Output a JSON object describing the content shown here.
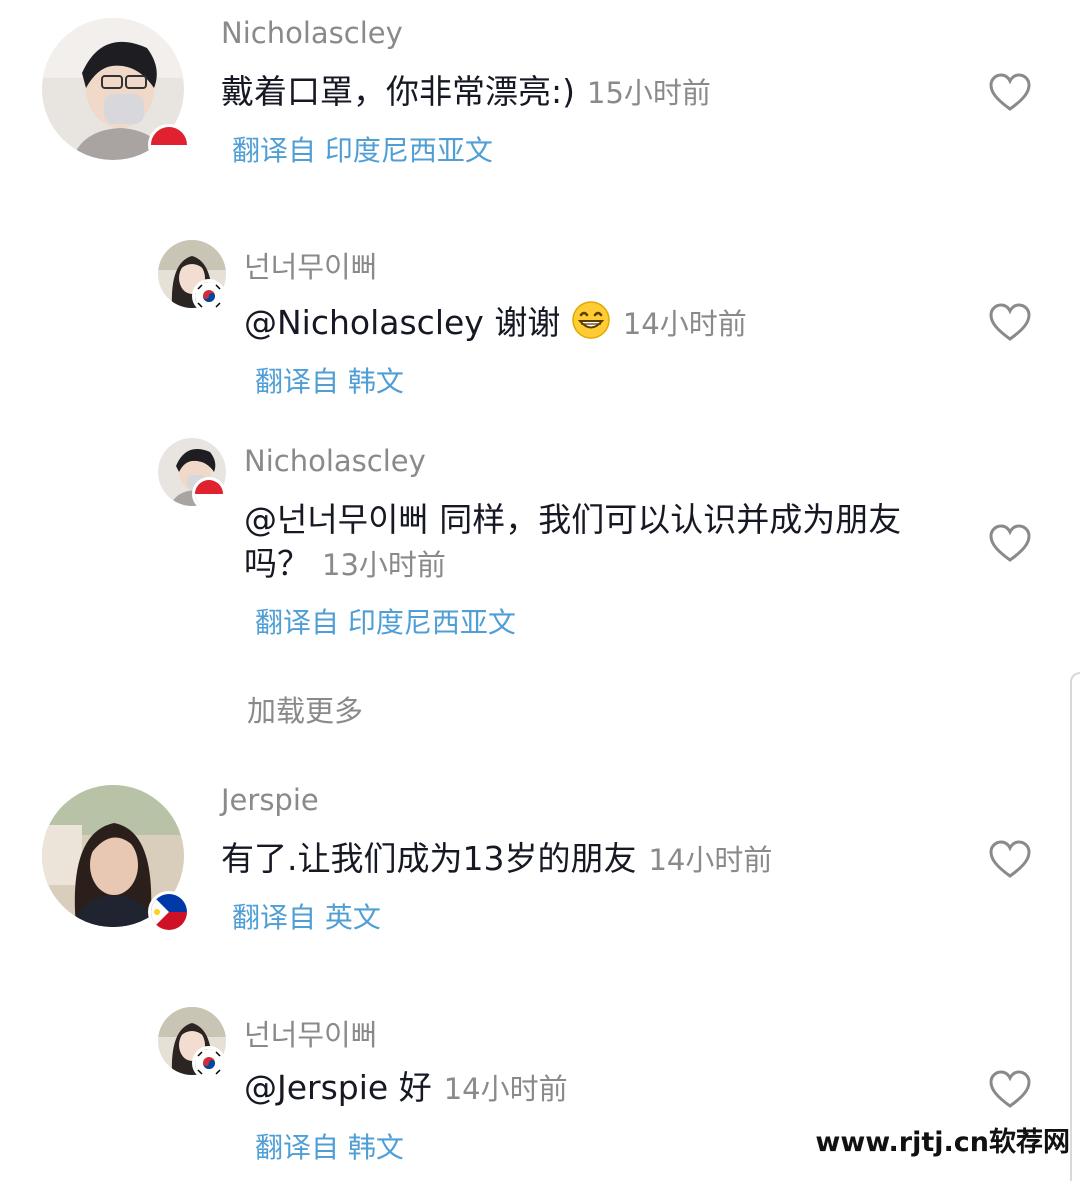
{
  "comments": [
    {
      "username": "Nicholascley",
      "text": "戴着口罩，你非常漂亮:)",
      "time": "15小时前",
      "translate": "翻译自 印度尼西亚文",
      "flag": "indonesia-flag-icon"
    },
    {
      "username": "넌너무이뻐",
      "text": "@Nicholascley 谢谢",
      "emoji": "grinning-face-icon",
      "time": "14小时前",
      "translate": "翻译自 韩文",
      "flag": "south-korea-flag-icon"
    },
    {
      "username": "Nicholascley",
      "text": "@넌너무이뻐 同样，我们可以认识并成为朋友吗？",
      "time": "13小时前",
      "translate": "翻译自 印度尼西亚文",
      "flag": "indonesia-flag-icon"
    },
    {
      "username": "Jerspie",
      "text": "有了.让我们成为13岁的朋友",
      "time": "14小时前",
      "translate": "翻译自 英文",
      "flag": "philippines-flag-icon"
    },
    {
      "username": "넌너무이뻐",
      "text": "@Jerspie 好",
      "time": "14小时前",
      "translate": "翻译自 韩文",
      "flag": "south-korea-flag-icon"
    }
  ],
  "load_more": "加载更多",
  "watermark": "www.rjtj.cn软荐网",
  "colors": {
    "username": "#8a8a8a",
    "translate_link": "#4f9fd6",
    "body_text": "#161823"
  }
}
